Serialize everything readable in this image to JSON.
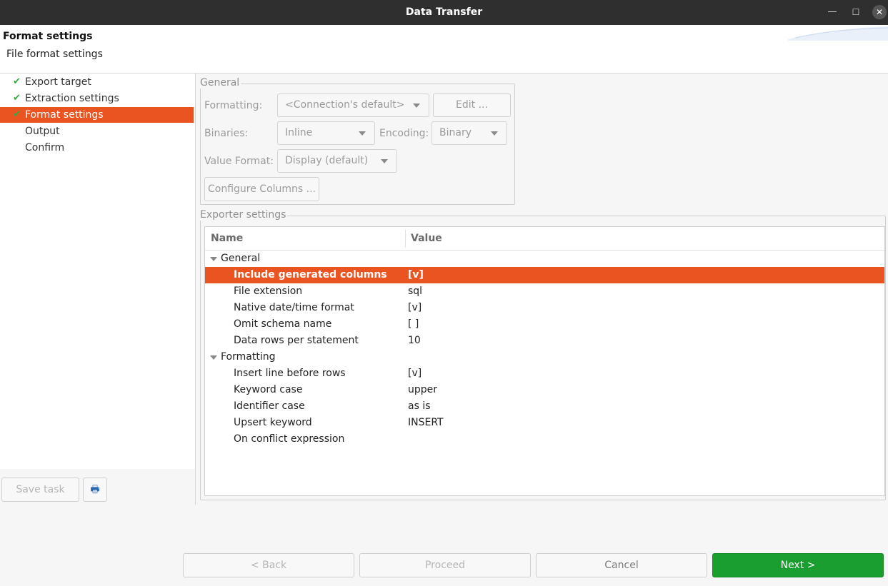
{
  "window": {
    "title": "Data Transfer",
    "minimize": "—",
    "maximize": "☐",
    "close": "✕"
  },
  "header": {
    "title": "Format settings",
    "subtitle": "File format settings"
  },
  "nav": {
    "items": [
      {
        "label": "Export target",
        "done": true,
        "active": false
      },
      {
        "label": "Extraction settings",
        "done": true,
        "active": false
      },
      {
        "label": "Format settings",
        "done": true,
        "active": true
      },
      {
        "label": "Output",
        "done": false,
        "active": false
      },
      {
        "label": "Confirm",
        "done": false,
        "active": false
      }
    ],
    "check_glyph": "✔",
    "save_task": "Save task",
    "print_icon": "🖶"
  },
  "general": {
    "legend": "General",
    "formatting_label": "Formatting:",
    "formatting_value": "<Connection's default>",
    "edit_button": "Edit ...",
    "binaries_label": "Binaries:",
    "binaries_value": "Inline",
    "encoding_label": "Encoding:",
    "encoding_value": "Binary",
    "value_format_label": "Value Format:",
    "value_format_value": "Display (default)",
    "configure_columns": "Configure Columns ..."
  },
  "exporter": {
    "legend": "Exporter settings",
    "col_name": "Name",
    "col_value": "Value",
    "groups": [
      {
        "name": "General",
        "rows": [
          {
            "name": "Include generated columns",
            "value": "[v]",
            "selected": true
          },
          {
            "name": "File extension",
            "value": "sql",
            "selected": false
          },
          {
            "name": "Native date/time format",
            "value": "[v]",
            "selected": false
          },
          {
            "name": "Omit schema name",
            "value": "[ ]",
            "selected": false
          },
          {
            "name": "Data rows per statement",
            "value": "10",
            "selected": false
          }
        ]
      },
      {
        "name": "Formatting",
        "rows": [
          {
            "name": "Insert line before rows",
            "value": "[v]",
            "selected": false
          },
          {
            "name": "Keyword case",
            "value": "upper",
            "selected": false
          },
          {
            "name": "Identifier case",
            "value": "as is",
            "selected": false
          },
          {
            "name": "Upsert keyword",
            "value": "INSERT",
            "selected": false
          },
          {
            "name": "On conflict expression",
            "value": "",
            "selected": false
          }
        ]
      }
    ]
  },
  "footer": {
    "back": "< Back",
    "proceed": "Proceed",
    "cancel": "Cancel",
    "next": "Next >"
  },
  "colors": {
    "accent": "#e95420",
    "primary_button": "#1a9e2f",
    "check": "#3aa641"
  }
}
